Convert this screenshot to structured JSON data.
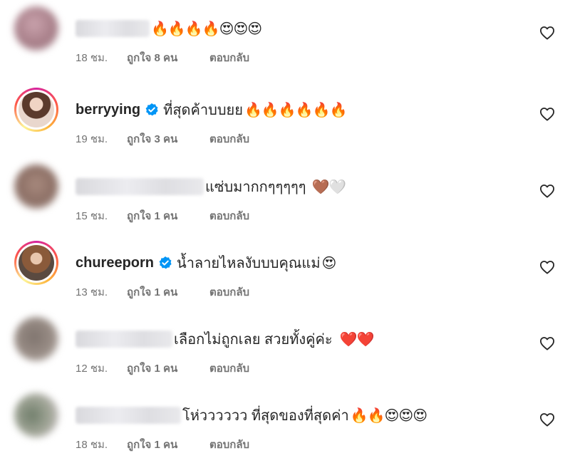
{
  "comments": [
    {
      "username": "",
      "username_blurred": true,
      "verified": false,
      "text": "",
      "emojis": "🔥🔥🔥🔥😍😍😍",
      "time": "18 ชม.",
      "likes": "ถูกใจ 8 คน",
      "reply": "ตอบกลับ",
      "avatar_color": "#b48a96"
    },
    {
      "username": "berryying",
      "username_blurred": false,
      "verified": true,
      "text": "ที่สุดค้าบบยย",
      "emojis": "🔥🔥🔥🔥🔥🔥",
      "time": "19 ชม.",
      "likes": "ถูกใจ 3 คน",
      "reply": "ตอบกลับ",
      "avatar_color": "#c79a86"
    },
    {
      "username": "",
      "username_blurred": true,
      "verified": false,
      "text": "แซ่บมากกๆๆๆๆๆ",
      "emojis": "🤎🤍",
      "time": "15 ชม.",
      "likes": "ถูกใจ 1 คน",
      "reply": "ตอบกลับ",
      "avatar_color": "#9c8176"
    },
    {
      "username": "chureeporn",
      "username_blurred": false,
      "verified": true,
      "text": "น้ำลายไหลงับบบคุณแม่",
      "emojis": "😍",
      "time": "13 ชม.",
      "likes": "ถูกใจ 1 คน",
      "reply": "ตอบกลับ",
      "avatar_color": "#a47a5e"
    },
    {
      "username": "",
      "username_blurred": true,
      "verified": false,
      "text": "เลือกไม่ถูกเลย สวยทั้งคู่ค่ะ",
      "emojis": "❤️❤️",
      "time": "12 ชม.",
      "likes": "ถูกใจ 1 คน",
      "reply": "ตอบกลับ",
      "avatar_color": "#8a7f78"
    },
    {
      "username": "",
      "username_blurred": true,
      "verified": false,
      "text": "โห่วววววว ที่สุดของที่สุดค่า",
      "emojis": "🔥🔥😍😍😍",
      "time": "18 ชม.",
      "likes": "ถูกใจ 1 คน",
      "reply": "ตอบกลับ",
      "avatar_color": "#8e9a86"
    }
  ],
  "icons": {
    "like": "heart-outline-icon",
    "verified": "verified-badge-icon"
  },
  "colors": {
    "text": "#262626",
    "meta": "#737373",
    "verified": "#0095f6"
  }
}
